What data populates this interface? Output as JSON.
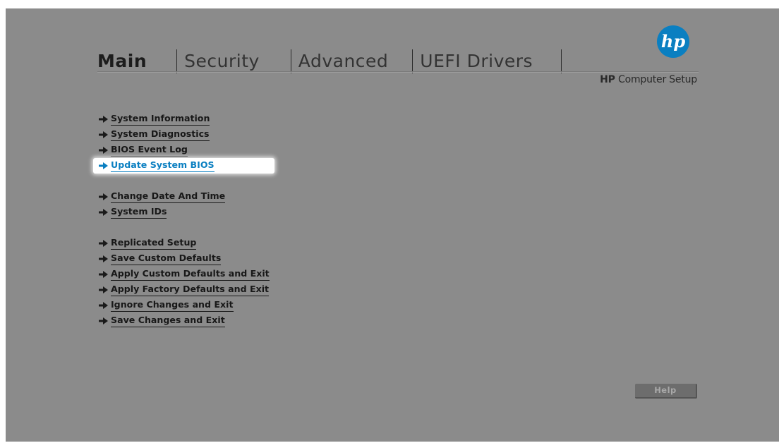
{
  "tabs": [
    {
      "label": "Main"
    },
    {
      "label": "Security"
    },
    {
      "label": "Advanced"
    },
    {
      "label": "UEFI Drivers"
    }
  ],
  "header": {
    "brand": "HP",
    "title": "Computer Setup",
    "logo_text": "hp",
    "logo_color": "#0a7fc1"
  },
  "menu": {
    "groups": [
      {
        "items": [
          {
            "label": "System Information"
          },
          {
            "label": "System Diagnostics"
          },
          {
            "label": "BIOS Event Log"
          },
          {
            "label": "Update System BIOS",
            "selected": true
          }
        ]
      },
      {
        "items": [
          {
            "label": "Change Date And Time"
          },
          {
            "label": "System IDs"
          }
        ]
      },
      {
        "items": [
          {
            "label": "Replicated Setup"
          },
          {
            "label": "Save Custom Defaults"
          },
          {
            "label": "Apply Custom Defaults and Exit"
          },
          {
            "label": "Apply Factory Defaults and Exit"
          },
          {
            "label": "Ignore Changes and Exit"
          },
          {
            "label": "Save Changes and Exit"
          }
        ]
      }
    ]
  },
  "help_button": {
    "label": "Help"
  },
  "colors": {
    "background": "#8b8b8b",
    "accent": "#0a7fc1",
    "text": "#181818"
  }
}
